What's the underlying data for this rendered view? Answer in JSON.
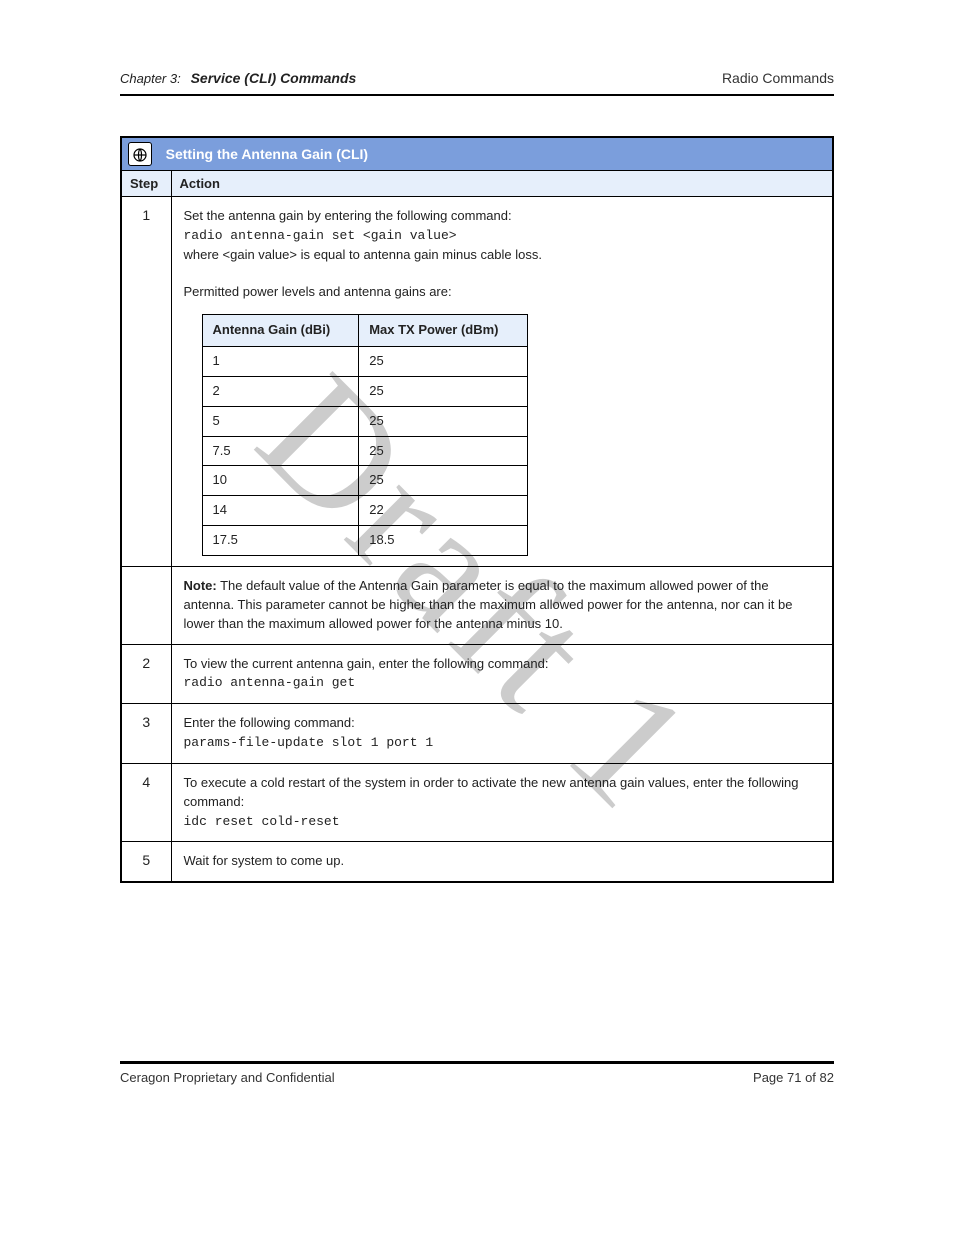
{
  "meta": {
    "chapter_prefix": "Chapter 3:",
    "chapter_title": "Service (CLI) Commands",
    "page_section": "Radio Commands"
  },
  "bar": {
    "title": "Setting the Antenna Gain (CLI)"
  },
  "columns": {
    "step": "Step",
    "action": "Action"
  },
  "rows": [
    {
      "step": "1",
      "intro": "Set the antenna gain by entering the following command:",
      "cmd": "radio antenna-gain set <gain value>",
      "hint": "where <gain value> is equal to antenna gain minus cable loss.",
      "table_title": "Permitted power levels and antenna gains are:",
      "table": {
        "header": [
          "Antenna Gain (dBi)",
          "Max TX Power (dBm)"
        ],
        "data": [
          [
            "1",
            "25"
          ],
          [
            "2",
            "25"
          ],
          [
            "5",
            "25"
          ],
          [
            "7.5",
            "25"
          ],
          [
            "10",
            "25"
          ],
          [
            "14",
            "22"
          ],
          [
            "17.5",
            "18.5"
          ]
        ]
      }
    },
    {
      "step": "",
      "note_label": "Note:",
      "note": "The default value of the Antenna Gain parameter is equal to the maximum allowed power of the antenna. This parameter cannot be higher than the maximum allowed power for the antenna, nor can it be lower than the maximum allowed power for the antenna minus 10."
    },
    {
      "step": "2",
      "text": "To view the current antenna gain, enter the following command:",
      "cmd": "radio antenna-gain get"
    },
    {
      "step": "3",
      "text": "Enter the following command:",
      "cmd": "params-file-update slot 1 port 1"
    },
    {
      "step": "4",
      "text": "To execute a cold restart of the system in order to activate the new antenna gain values, enter the following command:",
      "cmd": "idc reset cold-reset"
    },
    {
      "step": "5",
      "text": "Wait for system to come up."
    }
  ],
  "footer": {
    "left": "Ceragon Proprietary and Confidential",
    "right": "Page 71 of 82"
  },
  "watermark": "Draft 1"
}
